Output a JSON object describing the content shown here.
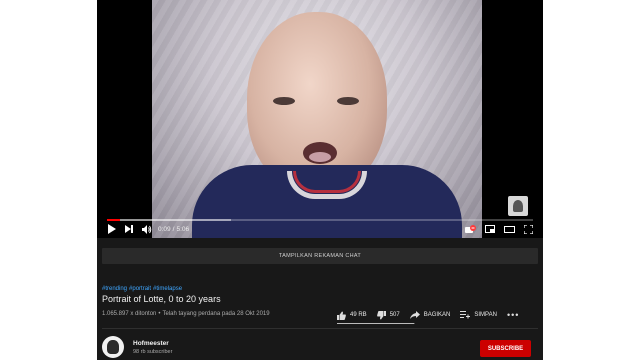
{
  "player": {
    "time_current": "0:09",
    "time_separator": "/",
    "time_total": "5:06",
    "played_fraction": 0.03,
    "loaded_fraction": 0.29,
    "icons": {
      "play": "play-icon",
      "next": "next-icon",
      "volume": "volume-icon",
      "autoplay": "autoplay-toggle-icon",
      "miniplayer": "miniplayer-icon",
      "theater": "theater-mode-icon",
      "fullscreen": "fullscreen-icon"
    }
  },
  "chat": {
    "label": "TAMPILKAN REKAMAN CHAT"
  },
  "video": {
    "hashtags": [
      "#trending",
      "#portrait",
      "#timelapse"
    ],
    "title": "Portrait of Lotte, 0 to 20 years",
    "views": "1.065.897 x ditonton",
    "separator": "•",
    "premiere": "Telah tayang perdana pada 28 Okt 2019"
  },
  "actions": {
    "likes": "49 RB",
    "dislikes": "507",
    "share": "BAGIKAN",
    "save": "SIMPAN",
    "more": "•••",
    "like_ratio": 0.99
  },
  "channel": {
    "name": "Hofmeester",
    "subscribers": "98 rb subscriber",
    "subscribe_label": "SUBSCRIBE"
  },
  "colors": {
    "accent": "#ff0000",
    "link": "#3ea6ff",
    "subscribe": "#cc0000",
    "background": "#181818"
  }
}
